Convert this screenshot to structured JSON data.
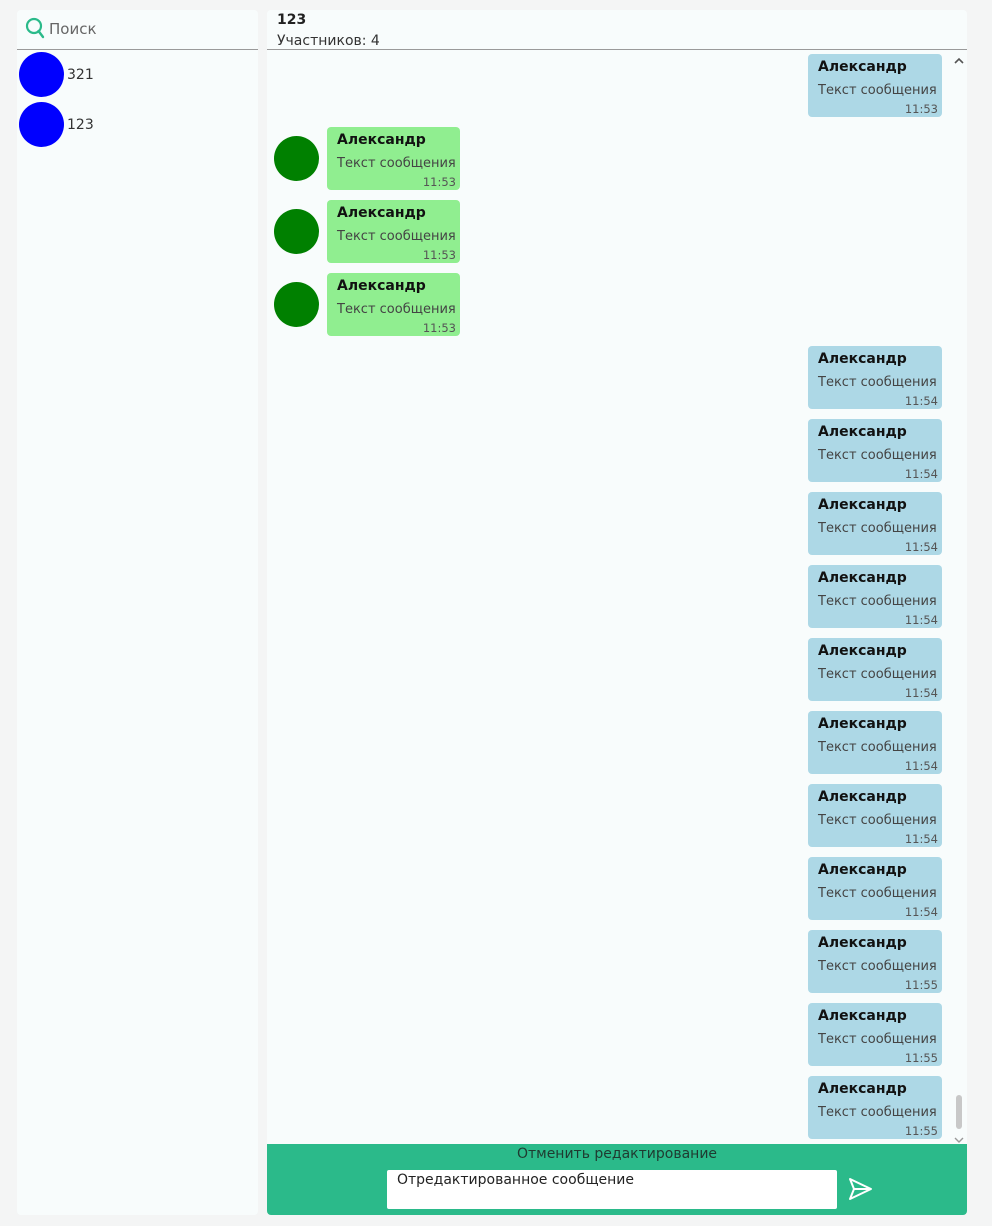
{
  "search": {
    "placeholder": "Поиск"
  },
  "contacts": [
    {
      "name": "321",
      "avatar_color": "#0000ff"
    },
    {
      "name": "123",
      "avatar_color": "#0000ff"
    }
  ],
  "chat": {
    "title": "123",
    "subtitle": "Участников: 4",
    "messages": [
      {
        "direction": "out",
        "author": "Александр",
        "text": "Текст сообщения",
        "time": "11:53"
      },
      {
        "direction": "in",
        "author": "Александр",
        "text": "Текст сообщения",
        "time": "11:53"
      },
      {
        "direction": "in",
        "author": "Александр",
        "text": "Текст сообщения",
        "time": "11:53"
      },
      {
        "direction": "in",
        "author": "Александр",
        "text": "Текст сообщения",
        "time": "11:53"
      },
      {
        "direction": "out",
        "author": "Александр",
        "text": "Текст сообщения",
        "time": "11:54"
      },
      {
        "direction": "out",
        "author": "Александр",
        "text": "Текст сообщения",
        "time": "11:54"
      },
      {
        "direction": "out",
        "author": "Александр",
        "text": "Текст сообщения",
        "time": "11:54"
      },
      {
        "direction": "out",
        "author": "Александр",
        "text": "Текст сообщения",
        "time": "11:54"
      },
      {
        "direction": "out",
        "author": "Александр",
        "text": "Текст сообщения",
        "time": "11:54"
      },
      {
        "direction": "out",
        "author": "Александр",
        "text": "Текст сообщения",
        "time": "11:54"
      },
      {
        "direction": "out",
        "author": "Александр",
        "text": "Текст сообщения",
        "time": "11:54"
      },
      {
        "direction": "out",
        "author": "Александр",
        "text": "Текст сообщения",
        "time": "11:54"
      },
      {
        "direction": "out",
        "author": "Александр",
        "text": "Текст сообщения",
        "time": "11:55"
      },
      {
        "direction": "out",
        "author": "Александр",
        "text": "Текст сообщения",
        "time": "11:55"
      },
      {
        "direction": "out",
        "author": "Александр",
        "text": "Текст сообщения",
        "time": "11:55"
      }
    ]
  },
  "composer": {
    "cancel_label": "Отменить редактирование",
    "input_value": "Отредактированное сообщение"
  },
  "colors": {
    "accent": "#2bba8a",
    "incoming_bubble": "#90ee90",
    "outgoing_bubble": "#add8e6",
    "incoming_avatar": "#008000",
    "contact_avatar": "#0000ff"
  },
  "icons": {
    "search": "search-icon",
    "send": "send-icon",
    "scroll_up": "chevron-up-icon",
    "scroll_down": "chevron-down-icon"
  }
}
